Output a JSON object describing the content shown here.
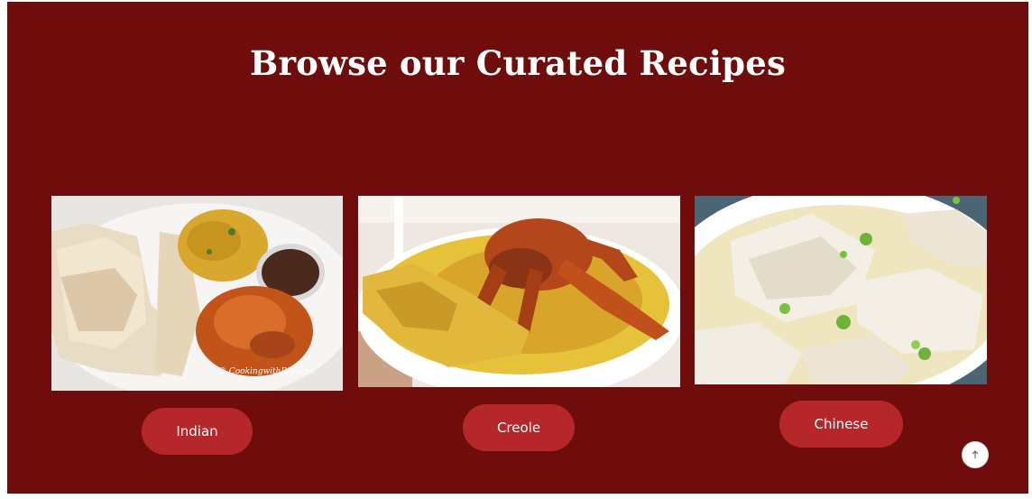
{
  "section": {
    "title": "Browse our Curated Recipes"
  },
  "cards": [
    {
      "label": "Indian",
      "image": "indian-food-photo",
      "watermark": "© CookingwithRia.com"
    },
    {
      "label": "Creole",
      "image": "crab-curry-photo"
    },
    {
      "label": "Chinese",
      "image": "wonton-soup-photo"
    }
  ],
  "scroll_top": {
    "icon": "arrow-up-icon"
  },
  "colors": {
    "background": "#6e0d0b",
    "button": "#b5272b",
    "text": "#ffffff"
  }
}
